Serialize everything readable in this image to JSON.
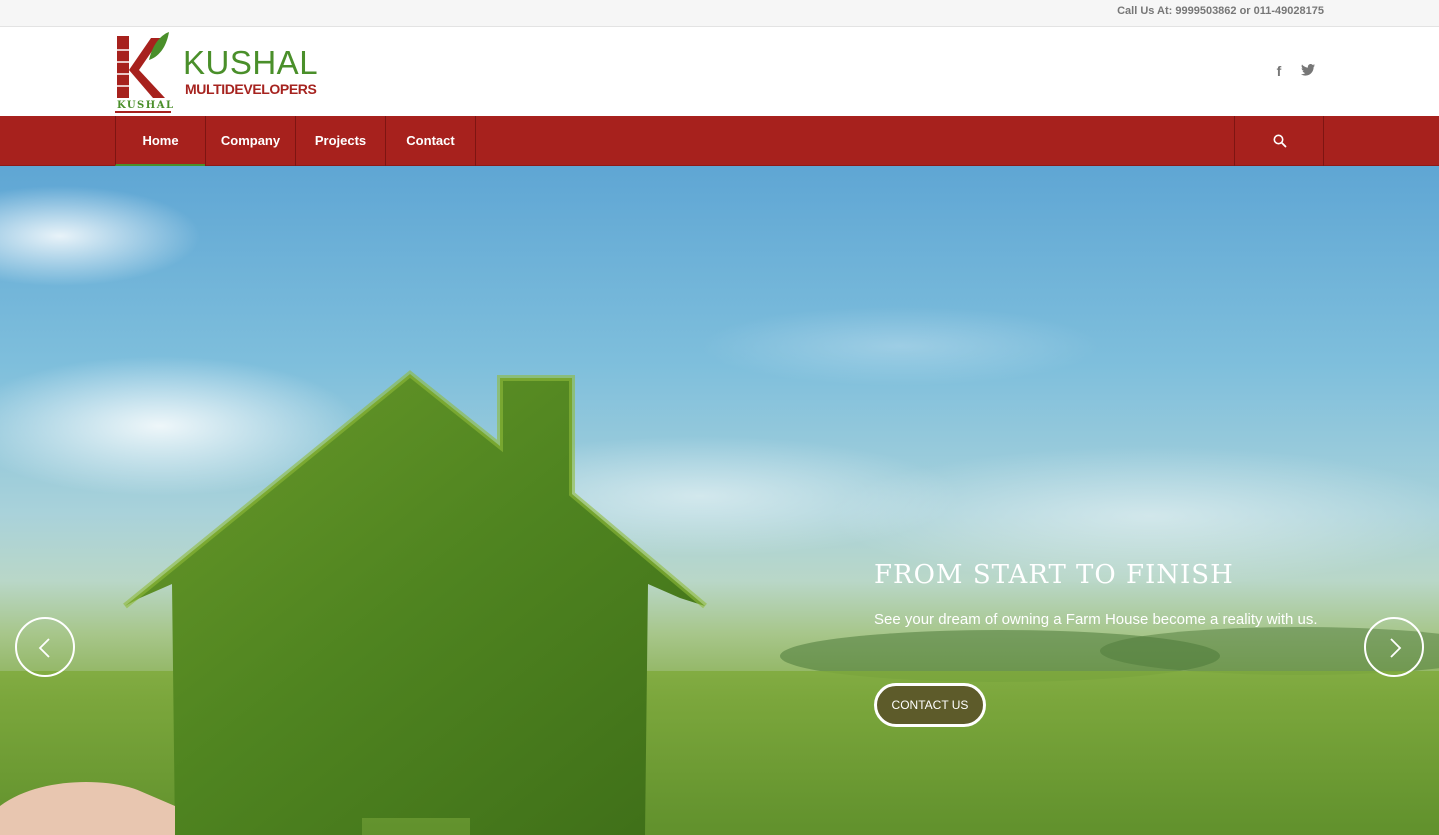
{
  "topbar": {
    "phone": "Call Us At: 9999503862 or 011-49028175"
  },
  "logo": {
    "name": "KUSHAL",
    "subtitle": "MULTIDEVELOPERS",
    "small": "KUSHAL"
  },
  "social": [
    {
      "icon": "facebook-icon",
      "glyph": "f"
    },
    {
      "icon": "twitter-icon",
      "glyph": "t"
    }
  ],
  "nav": {
    "items": [
      {
        "label": "Home",
        "active": true
      },
      {
        "label": "Company",
        "active": false
      },
      {
        "label": "Projects",
        "active": false
      },
      {
        "label": "Contact",
        "active": false
      }
    ],
    "search_icon": "search-icon"
  },
  "hero": {
    "title": "FROM START TO FINISH",
    "text": "See your dream of owning a Farm House become a reality with us.",
    "button": "CONTACT US",
    "prev_icon": "chevron-left-icon",
    "next_icon": "chevron-right-icon"
  },
  "colors": {
    "brand_red": "#a7211d",
    "brand_green": "#4a8f2a",
    "topbar": "#f6f6f6"
  }
}
